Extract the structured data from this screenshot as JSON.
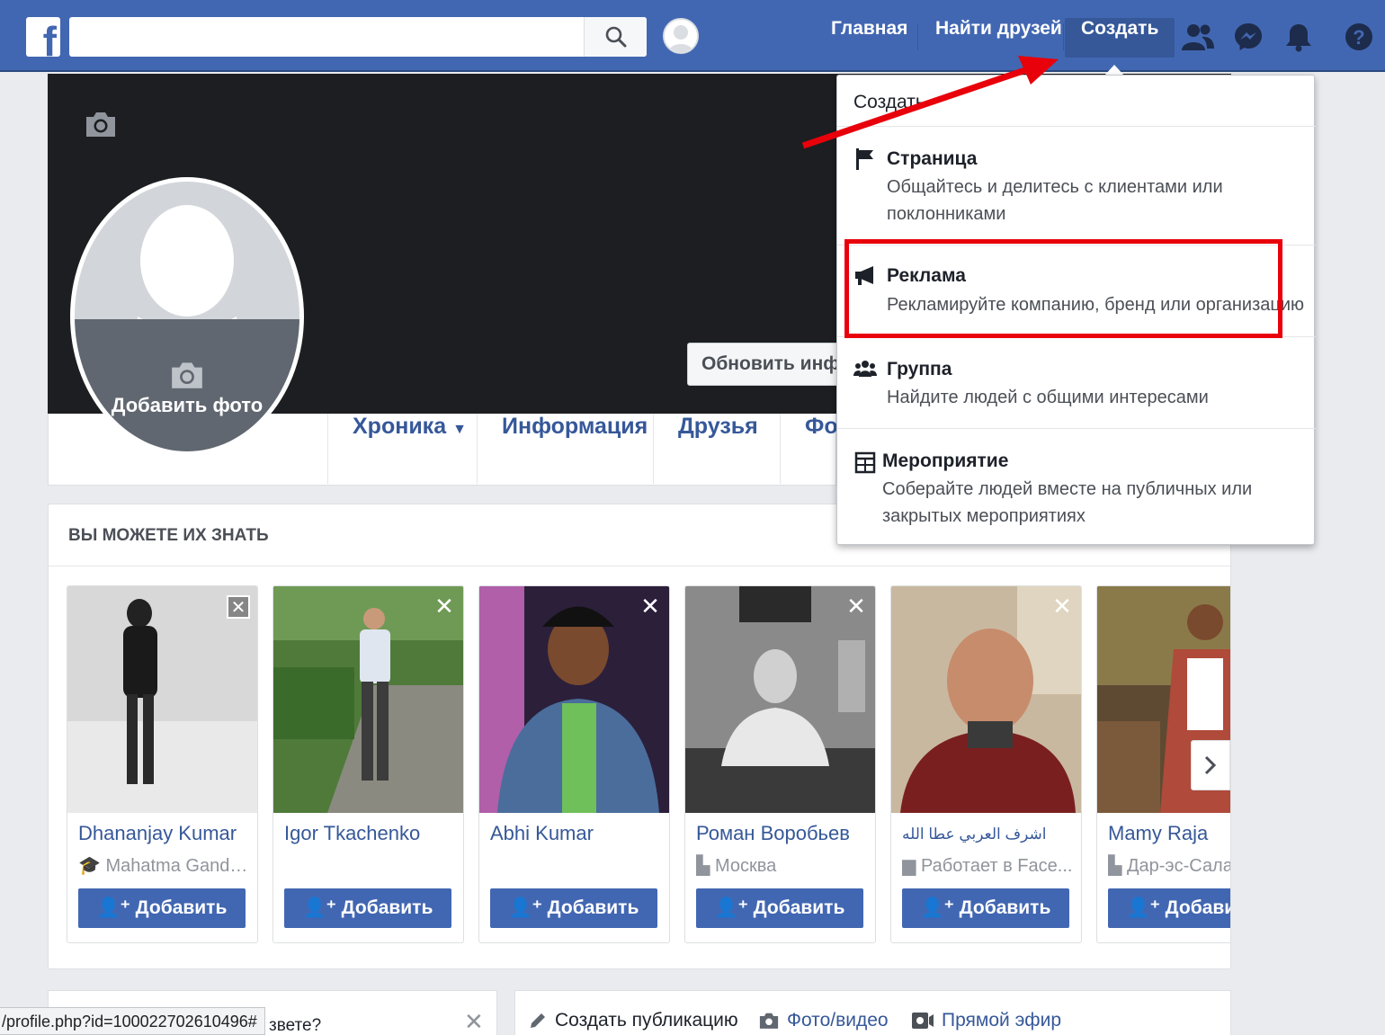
{
  "topbar": {
    "logo": "f",
    "search_value": "",
    "nav": {
      "home": "Главная",
      "find_friends": "Найти друзей",
      "create": "Создать"
    },
    "colors": {
      "bar": "#4267b2",
      "active": "#365899"
    }
  },
  "profile": {
    "add_photo": "Добавить фото",
    "update_info": "Обновить информацию",
    "tabs": {
      "timeline": "Хроника",
      "about": "Информация",
      "friends": "Друзья",
      "photos": "Фото"
    }
  },
  "dropdown": {
    "header": "Создать",
    "items": [
      {
        "title": "Страница",
        "desc_line1": "Общайтесь и делитесь с клиентами или",
        "desc_line2": "поклонниками",
        "icon": "flag-icon"
      },
      {
        "title": "Реклама",
        "desc_line1": "Рекламируйте компанию, бренд или организацию",
        "desc_line2": "",
        "icon": "megaphone-icon"
      },
      {
        "title": "Группа",
        "desc_line1": "Найдите людей с общими интересами",
        "desc_line2": "",
        "icon": "group-icon"
      },
      {
        "title": "Мероприятие",
        "desc_line1": "Соберайте людей вместе на публичных или",
        "desc_line2": "закрытых мероприятиях",
        "icon": "calendar-icon"
      }
    ],
    "highlight_color": "#e8000b"
  },
  "pymk": {
    "title": "ВЫ МОЖЕТЕ ИХ ЗНАТЬ",
    "add_label": "Добавить",
    "people": [
      {
        "name": "Dhananjay Kumar",
        "sub": "Mahatma Gandhi ..",
        "sub_icon": "school-icon"
      },
      {
        "name": "Igor Tkachenko",
        "sub": "",
        "sub_icon": ""
      },
      {
        "name": "Abhi Kumar",
        "sub": "",
        "sub_icon": ""
      },
      {
        "name": "Роман Воробьев",
        "sub": "Москва",
        "sub_icon": "city-icon"
      },
      {
        "name": "اشرف العربي عطا الله",
        "sub": "Работает в Face...",
        "sub_icon": "work-icon"
      },
      {
        "name": "Mamy Raja",
        "sub": "Дар-эс-Салам",
        "sub_icon": "city-icon"
      }
    ]
  },
  "bottom": {
    "url": "/profile.php?id=100022702610496#",
    "question": "звете?",
    "composer": {
      "create_post": "Создать публикацию",
      "photo_video": "Фото/видео",
      "live": "Прямой эфир"
    }
  }
}
